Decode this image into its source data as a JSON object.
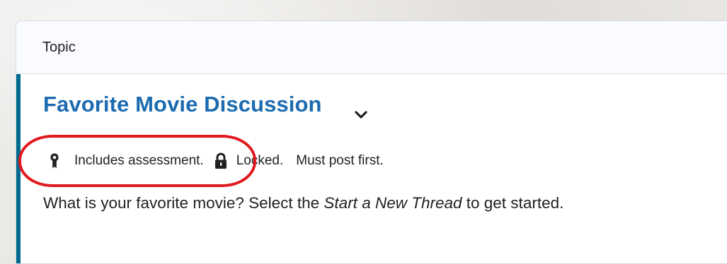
{
  "header": {
    "label": "Topic"
  },
  "topic": {
    "title": "Favorite Movie Discussion",
    "menu_icon": "chevron-down-icon",
    "accent_color": "#006a8e",
    "title_color": "#1c6bb0",
    "meta": {
      "assessment_icon": "award-ribbon-icon",
      "assessment_text": "Includes assessment.",
      "lock_icon": "lock-icon",
      "locked_text": "Locked.",
      "must_post_text": "Must post first."
    },
    "description": {
      "before": "What is your favorite movie?  Select the ",
      "emphasis": "Start a New Thread",
      "after": " to get started."
    }
  },
  "annotation": {
    "color": "#e0191f"
  }
}
